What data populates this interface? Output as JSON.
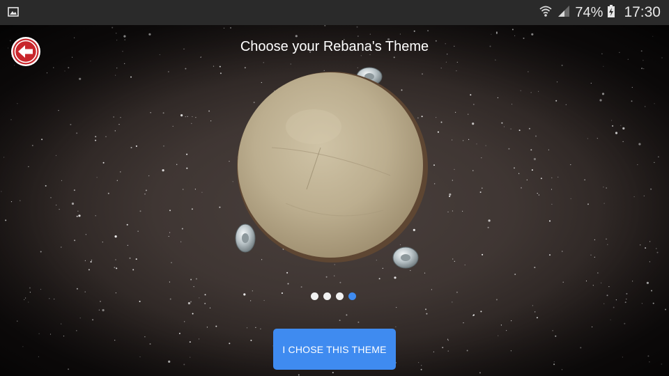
{
  "status_bar": {
    "notification_icon": "image-icon",
    "wifi_icon": "wifi-icon",
    "signal_icon": "signal-icon",
    "battery_percent": "74%",
    "battery_icon": "battery-charging-icon",
    "time": "17:30"
  },
  "header": {
    "back_icon": "back-arrow-icon",
    "title": "Choose your Rebana's Theme"
  },
  "carousel": {
    "item_image": "rebana-drum-image",
    "page_count": 4,
    "active_page": 4
  },
  "actions": {
    "choose_label": "I CHOSE THIS THEME"
  },
  "colors": {
    "accent": "#3f8bf0",
    "back_button_red": "#c8262c",
    "status_bar": "#2a2a2a"
  }
}
